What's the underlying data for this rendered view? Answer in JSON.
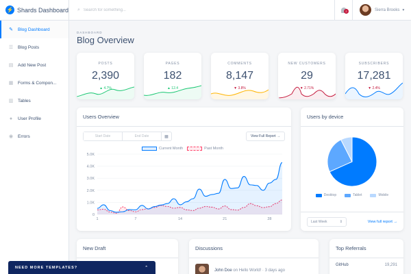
{
  "brand": {
    "name": "Shards Dashboard",
    "logo_icon": "bolt-icon"
  },
  "sidebar": {
    "items": [
      {
        "label": "Blog Dashboard",
        "icon": "pencil-icon",
        "active": true
      },
      {
        "label": "Blog Posts",
        "icon": "list-icon",
        "active": false
      },
      {
        "label": "Add New Post",
        "icon": "file-icon",
        "active": false
      },
      {
        "label": "Forms & Compon...",
        "icon": "forms-icon",
        "active": false
      },
      {
        "label": "Tables",
        "icon": "table-icon",
        "active": false
      },
      {
        "label": "User Profile",
        "icon": "user-icon",
        "active": false
      },
      {
        "label": "Errors",
        "icon": "error-icon",
        "active": false
      }
    ]
  },
  "topbar": {
    "search_placeholder": "Search for something...",
    "notification_count": "2",
    "user_name": "Sierra Brooks"
  },
  "page": {
    "subtitle": "Dashboard",
    "title": "Blog Overview"
  },
  "stats": [
    {
      "label": "Posts",
      "value": "2,390",
      "change": "4.7%",
      "direction": "up",
      "color": "#17c671"
    },
    {
      "label": "Pages",
      "value": "182",
      "change": "12.4",
      "direction": "up",
      "color": "#17c671"
    },
    {
      "label": "Comments",
      "value": "8,147",
      "change": "3.8%",
      "direction": "down",
      "color": "#ffb400"
    },
    {
      "label": "New Customers",
      "value": "29",
      "change": "2.71%",
      "direction": "down",
      "color": "#c4183c"
    },
    {
      "label": "Subscribers",
      "value": "17,281",
      "change": "2.4%",
      "direction": "down",
      "color": "#007bff"
    }
  ],
  "users_overview": {
    "title": "Users Overview",
    "start_placeholder": "Start Date",
    "end_placeholder": "End Date",
    "report_button": "View Full Report →"
  },
  "users_by_device": {
    "title": "Users by device",
    "period": "Last Week",
    "report_link": "View full report →"
  },
  "new_draft": {
    "title": "New Draft"
  },
  "discussions": {
    "title": "Discussions",
    "items": [
      {
        "author": "John Doe",
        "text": "on Hello World! · 3 days ago"
      }
    ]
  },
  "top_referrals": {
    "title": "Top Referrals",
    "items": [
      {
        "name": "GitHub",
        "count": "19,291"
      }
    ]
  },
  "promo": {
    "label": "Need More Templates?"
  },
  "chart_data": [
    {
      "type": "area",
      "x": [
        1,
        2,
        3,
        4,
        5,
        6,
        7,
        8,
        9,
        10,
        11,
        12,
        13,
        14,
        15,
        16,
        17,
        18,
        19,
        20,
        21,
        22,
        23,
        24,
        25,
        26,
        27,
        28,
        29,
        30
      ],
      "x_tick_labels": [
        "1",
        "7",
        "14",
        "21",
        "28"
      ],
      "y_tick_labels": [
        "0",
        "1.0K",
        "2.0K",
        "3.0K",
        "4.0K",
        "5.0K"
      ],
      "ylim": [
        0,
        5000
      ],
      "grid": true,
      "legend": "top-center",
      "series": [
        {
          "name": "Current Month",
          "color": "#007bff",
          "values": [
            500,
            800,
            320,
            180,
            220,
            400,
            380,
            750,
            450,
            650,
            780,
            900,
            1300,
            800,
            1050,
            1300,
            2100,
            1500,
            1650,
            1750,
            2900,
            2150,
            2200,
            3150,
            2450,
            2400,
            2000,
            2600,
            2900,
            4300
          ]
        },
        {
          "name": "Past Month",
          "color": "#ff4169",
          "values": [
            380,
            430,
            200,
            100,
            620,
            320,
            220,
            400,
            480,
            580,
            740,
            660,
            520,
            580,
            380,
            320,
            520,
            660,
            600,
            450,
            700,
            400,
            360,
            580,
            900,
            720,
            570,
            640,
            900,
            1200
          ]
        }
      ]
    },
    {
      "type": "pie",
      "categories": [
        "Desktop",
        "Tablet",
        "Mobile"
      ],
      "values": [
        68.3,
        24.2,
        7.5
      ],
      "colors": [
        "#007bff",
        "#5da8ff",
        "#b9d9ff"
      ],
      "legend": "bottom"
    }
  ]
}
